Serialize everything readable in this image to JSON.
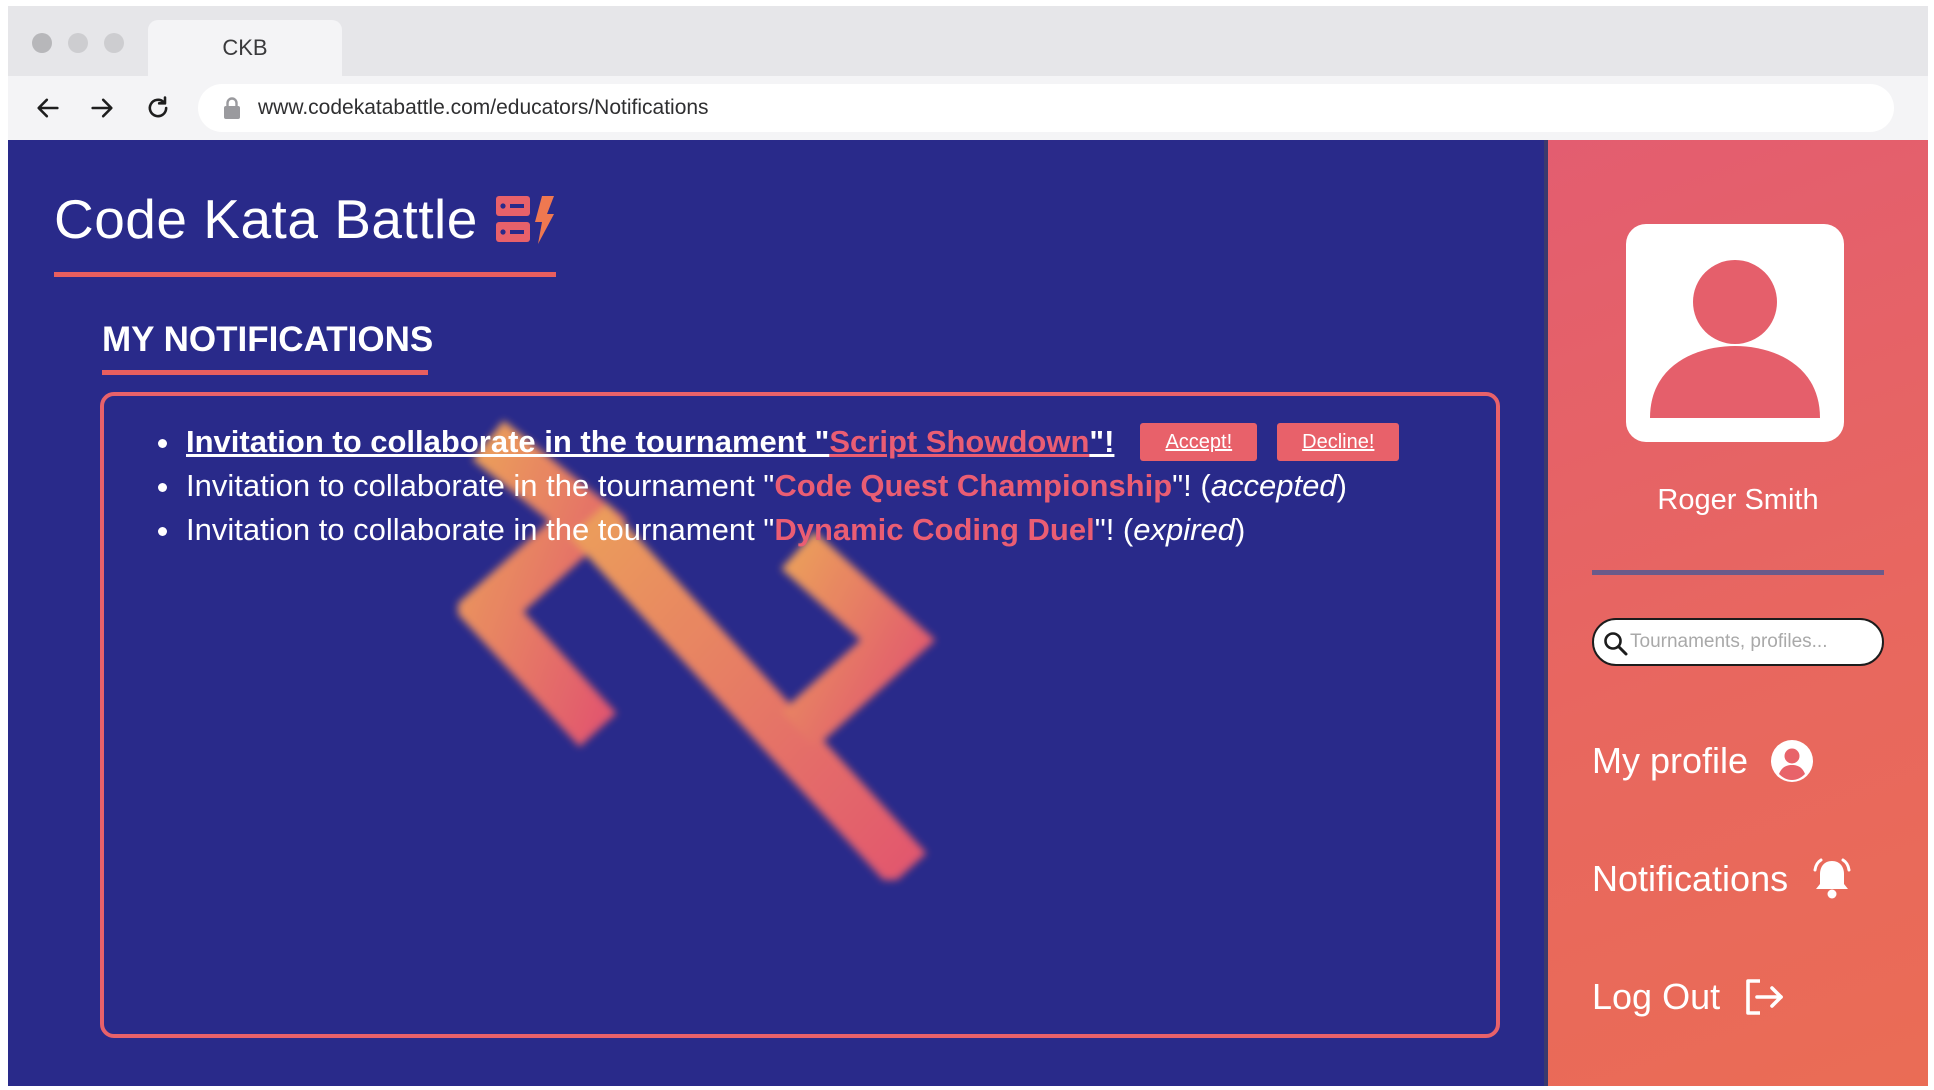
{
  "browser": {
    "tab_title": "CKB",
    "url": "www.codekatabattle.com/educators/Notifications"
  },
  "brand": {
    "title": "Code Kata Battle",
    "logo_icon": "ckb-logo-icon",
    "accent_color": "#e85e5f"
  },
  "page": {
    "section_title": "MY NOTIFICATIONS"
  },
  "notifications": [
    {
      "prefix": "Invitation to collaborate in the tournament \"",
      "tournament": "Script Showdown",
      "suffix": "\"!",
      "status": "",
      "unread": true,
      "accept_label": "Accept!",
      "decline_label": "Decline!"
    },
    {
      "prefix": "Invitation to collaborate in the tournament \"",
      "tournament": "Code Quest Championship",
      "suffix": "\"! (",
      "status": "accepted",
      "status_close": ")",
      "unread": false
    },
    {
      "prefix": "Invitation to collaborate in the tournament \"",
      "tournament": "Dynamic Coding Duel",
      "suffix": "\"! (",
      "status": "expired",
      "status_close": ")",
      "unread": false
    }
  ],
  "sidebar": {
    "user_name": "Roger Smith",
    "search_placeholder": "Tournaments, profiles...",
    "menu": [
      {
        "label": "My profile",
        "icon": "user-circle-icon"
      },
      {
        "label": "Notifications",
        "icon": "bell-icon"
      },
      {
        "label": "Log Out",
        "icon": "logout-icon"
      }
    ]
  },
  "colors": {
    "main_bg": "#292a8a",
    "sidebar_gradient_start": "#e35d70",
    "sidebar_gradient_end": "#ea6c55",
    "tournament_name": "#ea5d73"
  }
}
